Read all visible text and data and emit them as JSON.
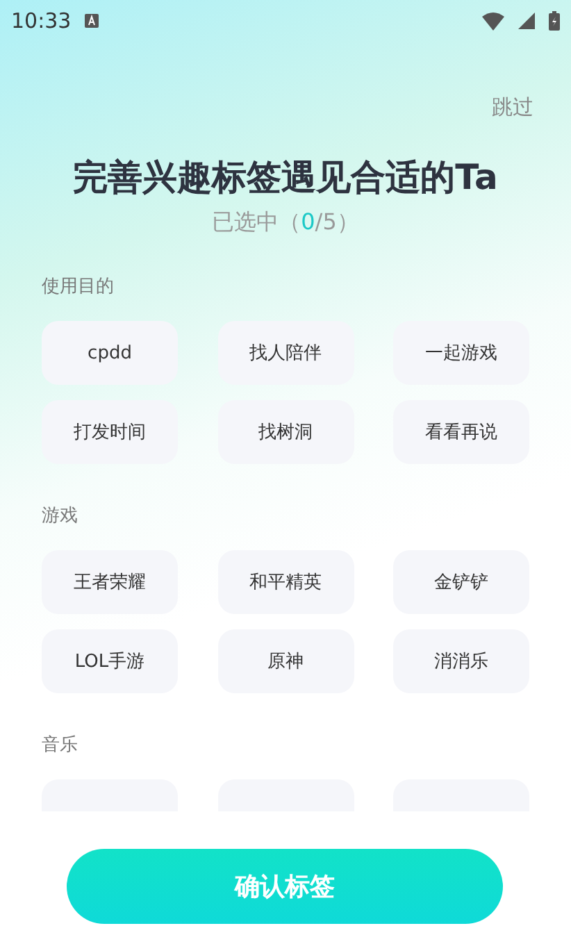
{
  "status_bar": {
    "time": "10:33"
  },
  "skip": "跳过",
  "title": "完善兴趣标签遇见合适的Ta",
  "counter": {
    "prefix": "已选中（",
    "count": "0",
    "suffix": "/5）"
  },
  "sections": [
    {
      "title": "使用目的",
      "tags": [
        {
          "label": "cpdd",
          "selected": false
        },
        {
          "label": "找人陪伴",
          "selected": false
        },
        {
          "label": "一起游戏",
          "selected": false
        },
        {
          "label": "打发时间",
          "selected": false
        },
        {
          "label": "找树洞",
          "selected": false
        },
        {
          "label": "看看再说",
          "selected": false
        }
      ]
    },
    {
      "title": "游戏",
      "tags": [
        {
          "label": "王者荣耀",
          "selected": false
        },
        {
          "label": "和平精英",
          "selected": false
        },
        {
          "label": "金铲铲",
          "selected": false
        },
        {
          "label": "LOL手游",
          "selected": false
        },
        {
          "label": "原神",
          "selected": false
        },
        {
          "label": "消消乐",
          "selected": false
        }
      ]
    },
    {
      "title": "音乐",
      "tags": [
        {
          "selected": false
        },
        {
          "selected": false
        },
        {
          "selected": false
        }
      ]
    }
  ],
  "confirm_button": "确认标签"
}
